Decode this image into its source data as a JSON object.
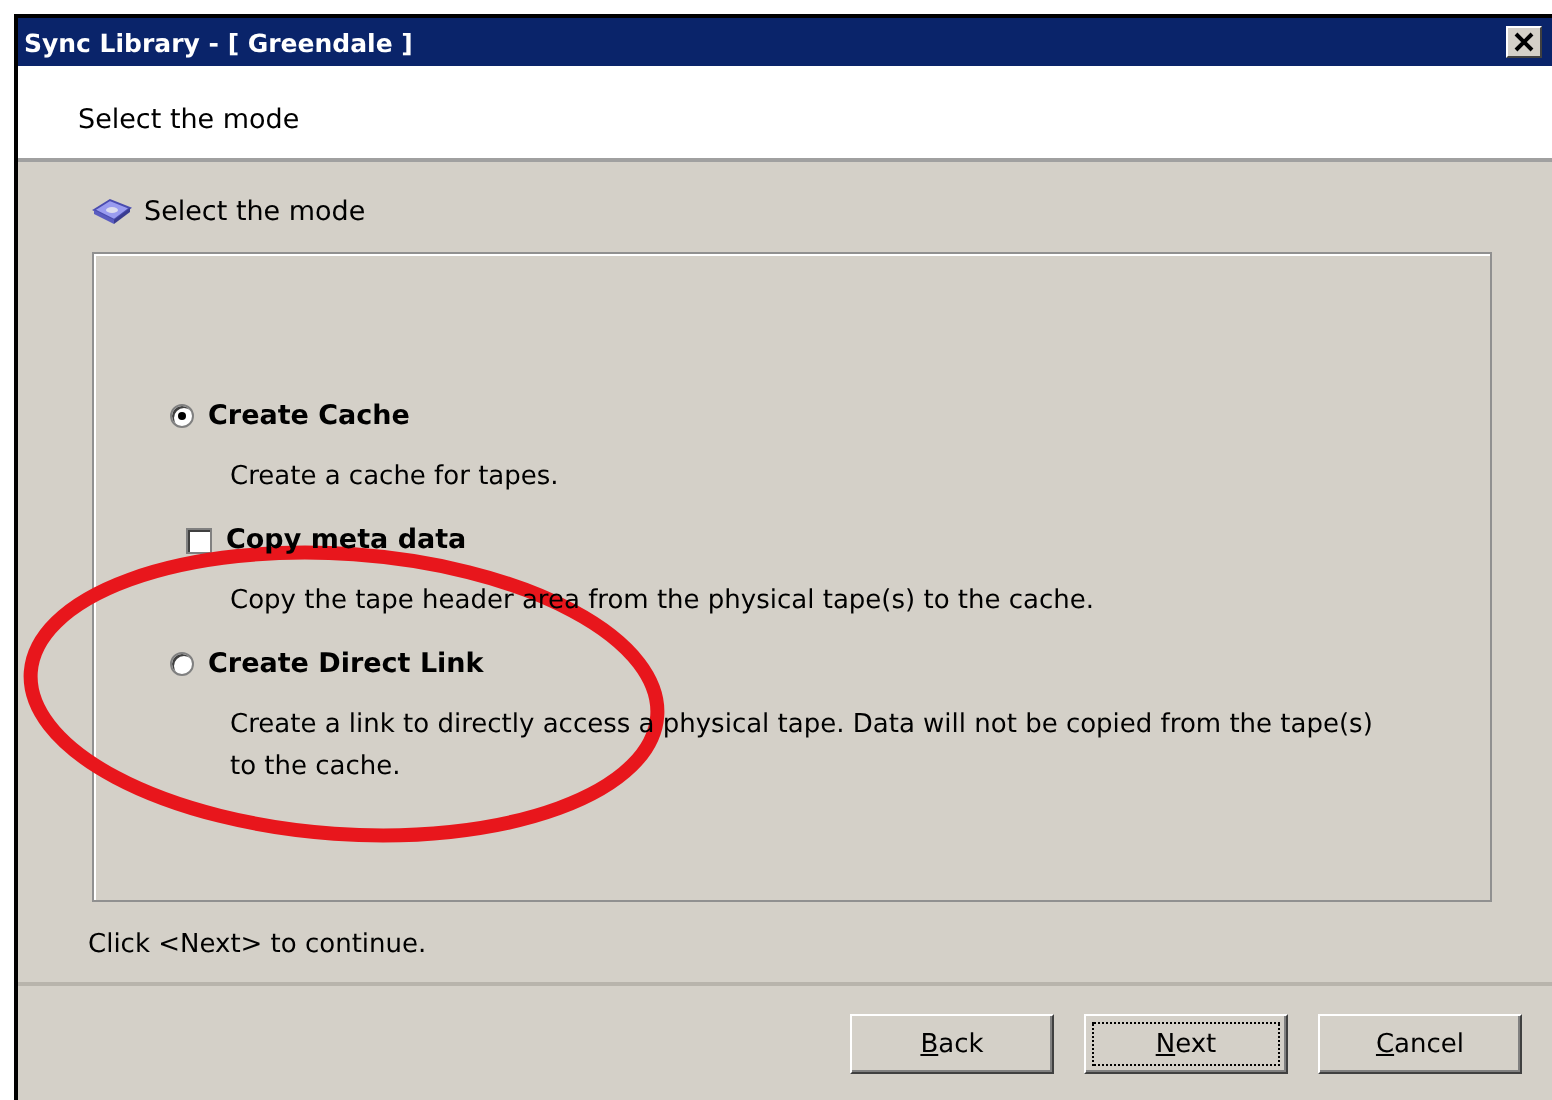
{
  "window": {
    "title": "Sync Library - [ Greendale ]"
  },
  "header": {
    "title": "Select the mode"
  },
  "section": {
    "title": "Select the mode"
  },
  "options": [
    {
      "kind": "radio",
      "label": "Create Cache",
      "selected": true,
      "description": "Create a cache for tapes."
    },
    {
      "kind": "checkbox",
      "label": "Copy meta data",
      "checked": false,
      "description": "Copy the tape header area from the physical tape(s) to the cache."
    },
    {
      "kind": "radio",
      "label": "Create Direct Link",
      "selected": false,
      "description": "Create a link to directly access a physical tape. Data will not be copied from the tape(s) to the cache."
    }
  ],
  "hint": "Click <Next> to continue.",
  "buttons": [
    {
      "label": "Back",
      "focused": false
    },
    {
      "label": "Next",
      "focused": true
    },
    {
      "label": "Cancel",
      "focused": false
    }
  ],
  "annotations": [
    {
      "kind": "ellipse"
    }
  ]
}
